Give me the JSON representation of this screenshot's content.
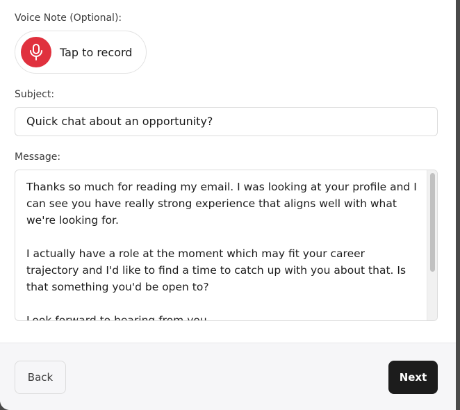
{
  "voice_note": {
    "label": "Voice Note (Optional):",
    "button_label": "Tap to record",
    "icon": "microphone-icon"
  },
  "subject": {
    "label": "Subject:",
    "value": "Quick chat about an opportunity?"
  },
  "message": {
    "label": "Message:",
    "value": "Thanks so much for reading my email. I was looking at your profile and I can see you have really strong experience that aligns well with what we're looking for.\n\nI actually have a role at the moment which may fit your career trajectory and I'd like to find a time to catch up with you about that. Is that something you'd be open to?\n\nLook forward to hearing from you."
  },
  "footer": {
    "back_label": "Back",
    "next_label": "Next"
  },
  "colors": {
    "accent_red": "#e0313e",
    "primary_dark": "#1c1c1c",
    "footer_bg": "#f6f6f8"
  }
}
